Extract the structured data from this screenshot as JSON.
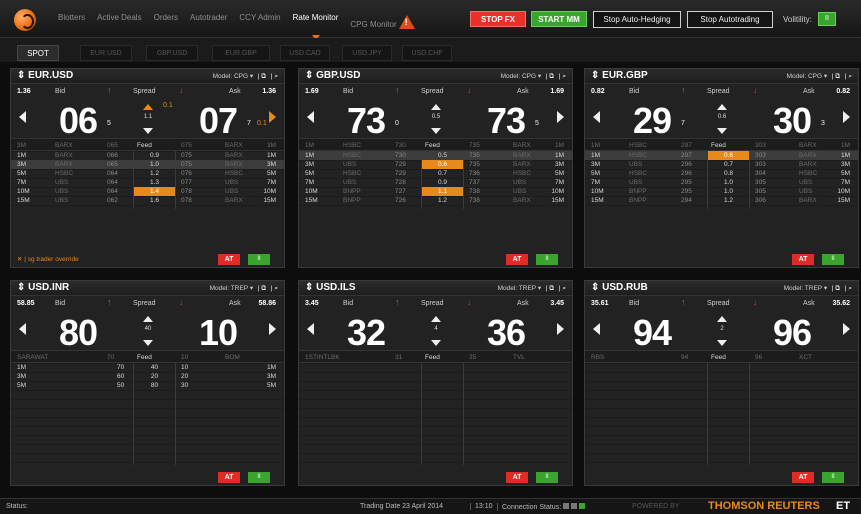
{
  "nav": {
    "items": [
      "Blotters",
      "Active Deals",
      "Orders",
      "Autotrader",
      "CCY Admin",
      "Rate Monitor",
      "CPG Monitor"
    ],
    "active": "Rate Monitor",
    "stop_fx": "STOP FX",
    "start_mm": "START MM",
    "stop_auto_hedging": "Stop Auto-Hedging",
    "stop_autotrading": "Stop Autotrading",
    "volatility_label": "Volitility:",
    "volatility_toggle": "II"
  },
  "tabs": [
    "SPOT",
    "EUR.USD",
    "GBP.USD",
    "EUR.GBP",
    "USD.CAD",
    "USD.JPY",
    "USD.CHF"
  ],
  "panels": [
    {
      "pair": "⇕ EUR.USD",
      "model": "Model: CPG ▾",
      "bid_rate": "1.36",
      "ask_rate": "1.36",
      "bid_label": "Bid",
      "ask_label": "Ask",
      "spread_label": "Spread",
      "big_bid": "06",
      "bid_pip": "5",
      "big_ask": "07",
      "ask_pip": "7",
      "spread": "1.1",
      "spread_note": "0.1",
      "ask_note": "0.1",
      "feed": {
        "tenor": "3M",
        "bank_l": "BARX",
        "bid": "065",
        "label": "Feed",
        "ask": "075",
        "bank_r": "BARX",
        "tenor_r": "3M"
      },
      "rows": [
        {
          "t": "1M",
          "b": "BARX",
          "bid": "066",
          "sp": "0.9",
          "ask": "075",
          "ab": "BARX",
          "tr": "1M"
        },
        {
          "t": "3M",
          "b": "BARX",
          "bid": "065",
          "sp": "1.0",
          "ask": "075",
          "ab": "BARX",
          "tr": "3M"
        },
        {
          "t": "5M",
          "b": "HSBC",
          "bid": "064",
          "sp": "1.2",
          "ask": "076",
          "ab": "HSBC",
          "tr": "5M"
        },
        {
          "t": "7M",
          "b": "UBS",
          "bid": "064",
          "sp": "1.3",
          "ask": "077",
          "ab": "UBS",
          "tr": "7M"
        },
        {
          "t": "10M",
          "b": "UBS",
          "bid": "064",
          "sp": "1.4",
          "ask": "078",
          "ab": "UBS",
          "tr": "10M"
        },
        {
          "t": "15M",
          "b": "UBS",
          "bid": "062",
          "sp": "1.6",
          "ask": "078",
          "ab": "BARX",
          "tr": "15M"
        }
      ],
      "override": "✕ | sg trader override",
      "at": "AT",
      "go": "II"
    },
    {
      "pair": "⇕ GBP.USD",
      "model": "Model: CPG ▾",
      "bid_rate": "1.69",
      "ask_rate": "1.69",
      "bid_label": "Bid",
      "ask_label": "Ask",
      "spread_label": "Spread",
      "big_bid": "73",
      "bid_pip": "0",
      "big_ask": "73",
      "ask_pip": "5",
      "spread": "0.5",
      "feed": {
        "tenor": "1M",
        "bank_l": "HSBC",
        "bid": "730",
        "label": "Feed",
        "ask": "735",
        "bank_r": "BARX",
        "tenor_r": "1M"
      },
      "rows": [
        {
          "t": "1M",
          "b": "HSBC",
          "bid": "730",
          "sp": "0.5",
          "ask": "735",
          "ab": "BARX",
          "tr": "1M"
        },
        {
          "t": "3M",
          "b": "UBS",
          "bid": "729",
          "sp": "0.6",
          "ask": "735",
          "ab": "BARX",
          "tr": "3M"
        },
        {
          "t": "5M",
          "b": "HSBC",
          "bid": "729",
          "sp": "0.7",
          "ask": "736",
          "ab": "HSBC",
          "tr": "5M"
        },
        {
          "t": "7M",
          "b": "UBS",
          "bid": "728",
          "sp": "0.9",
          "ask": "737",
          "ab": "UBS",
          "tr": "7M"
        },
        {
          "t": "10M",
          "b": "BNPP",
          "bid": "727",
          "sp": "1.1",
          "ask": "738",
          "ab": "UBS",
          "tr": "10M"
        },
        {
          "t": "15M",
          "b": "BNPP",
          "bid": "726",
          "sp": "1.2",
          "ask": "738",
          "ab": "BARX",
          "tr": "15M"
        }
      ],
      "at": "AT",
      "go": "II"
    },
    {
      "pair": "⇕ EUR.GBP",
      "model": "Model: CPG ▾",
      "bid_rate": "0.82",
      "ask_rate": "0.82",
      "bid_label": "Bid",
      "ask_label": "Ask",
      "spread_label": "Spread",
      "big_bid": "29",
      "bid_pip": "7",
      "big_ask": "30",
      "ask_pip": "3",
      "spread": "0.6",
      "feed": {
        "tenor": "1M",
        "bank_l": "HSBC",
        "bid": "297",
        "label": "Feed",
        "ask": "303",
        "bank_r": "BARX",
        "tenor_r": "1M"
      },
      "rows": [
        {
          "t": "1M",
          "b": "HSBC",
          "bid": "297",
          "sp": "0.6",
          "ask": "303",
          "ab": "BARX",
          "tr": "1M"
        },
        {
          "t": "3M",
          "b": "UBS",
          "bid": "296",
          "sp": "0.7",
          "ask": "303",
          "ab": "BARX",
          "tr": "3M"
        },
        {
          "t": "5M",
          "b": "HSBC",
          "bid": "296",
          "sp": "0.8",
          "ask": "304",
          "ab": "HSBC",
          "tr": "5M"
        },
        {
          "t": "7M",
          "b": "UBS",
          "bid": "295",
          "sp": "1.0",
          "ask": "305",
          "ab": "UBS",
          "tr": "7M"
        },
        {
          "t": "10M",
          "b": "BNPP",
          "bid": "295",
          "sp": "1.0",
          "ask": "305",
          "ab": "UBS",
          "tr": "10M"
        },
        {
          "t": "15M",
          "b": "BNPP",
          "bid": "294",
          "sp": "1.2",
          "ask": "306",
          "ab": "BARX",
          "tr": "15M"
        }
      ],
      "at": "AT",
      "go": "II"
    },
    {
      "pair": "⇕ USD.INR",
      "model": "Model: TREP ▾",
      "bid_rate": "58.85",
      "ask_rate": "58.86",
      "bid_label": "Bid",
      "ask_label": "Ask",
      "spread_label": "Spread",
      "big_bid": "80",
      "big_ask": "10",
      "spread": "40",
      "feed": {
        "tenor": "SARAWAT",
        "bid": "70",
        "label": "Feed",
        "ask": "10",
        "bank_r": "BOM"
      },
      "rows": [
        {
          "t": "1M",
          "bid": "70",
          "sp": "40",
          "ask": "10",
          "tr": "1M"
        },
        {
          "t": "3M",
          "bid": "60",
          "sp": "20",
          "ask": "20",
          "tr": "3M"
        },
        {
          "t": "5M",
          "bid": "50",
          "sp": "80",
          "ask": "30",
          "tr": "5M"
        }
      ],
      "at": "AT",
      "go": "II"
    },
    {
      "pair": "⇕ USD.ILS",
      "model": "Model: TREP ▾",
      "bid_rate": "3.45",
      "ask_rate": "3.45",
      "bid_label": "Bid",
      "ask_label": "Ask",
      "spread_label": "Spread",
      "big_bid": "32",
      "big_ask": "36",
      "spread": "4",
      "feed": {
        "tenor": "1STINTLBK",
        "bid": "31",
        "label": "Feed",
        "ask": "35",
        "bank_r": "TVL"
      },
      "rows": [],
      "at": "AT",
      "go": "II"
    },
    {
      "pair": "⇕ USD.RUB",
      "model": "Model: TREP ▾",
      "bid_rate": "35.61",
      "ask_rate": "35.62",
      "bid_label": "Bid",
      "ask_label": "Ask",
      "spread_label": "Spread",
      "big_bid": "94",
      "big_ask": "96",
      "spread": "2",
      "feed": {
        "tenor": "RBS",
        "bid": "94",
        "label": "Feed",
        "ask": "96",
        "bank_r": "XCT"
      },
      "rows": [],
      "at": "AT",
      "go": "II"
    }
  ],
  "status": {
    "label": "Status:",
    "trading_date": "Trading Date 23 April 2014",
    "time": "13:10",
    "connection": "Connection Status:",
    "powered": "POWERED BY",
    "brand": "THOMSON REUTERS",
    "et": "ET"
  },
  "colors": {
    "accent": "#e8891a",
    "stop": "#e02c26",
    "go": "#3aa52c",
    "up_arrow": "#3aa52c",
    "down_arrow": "#e02c26"
  }
}
